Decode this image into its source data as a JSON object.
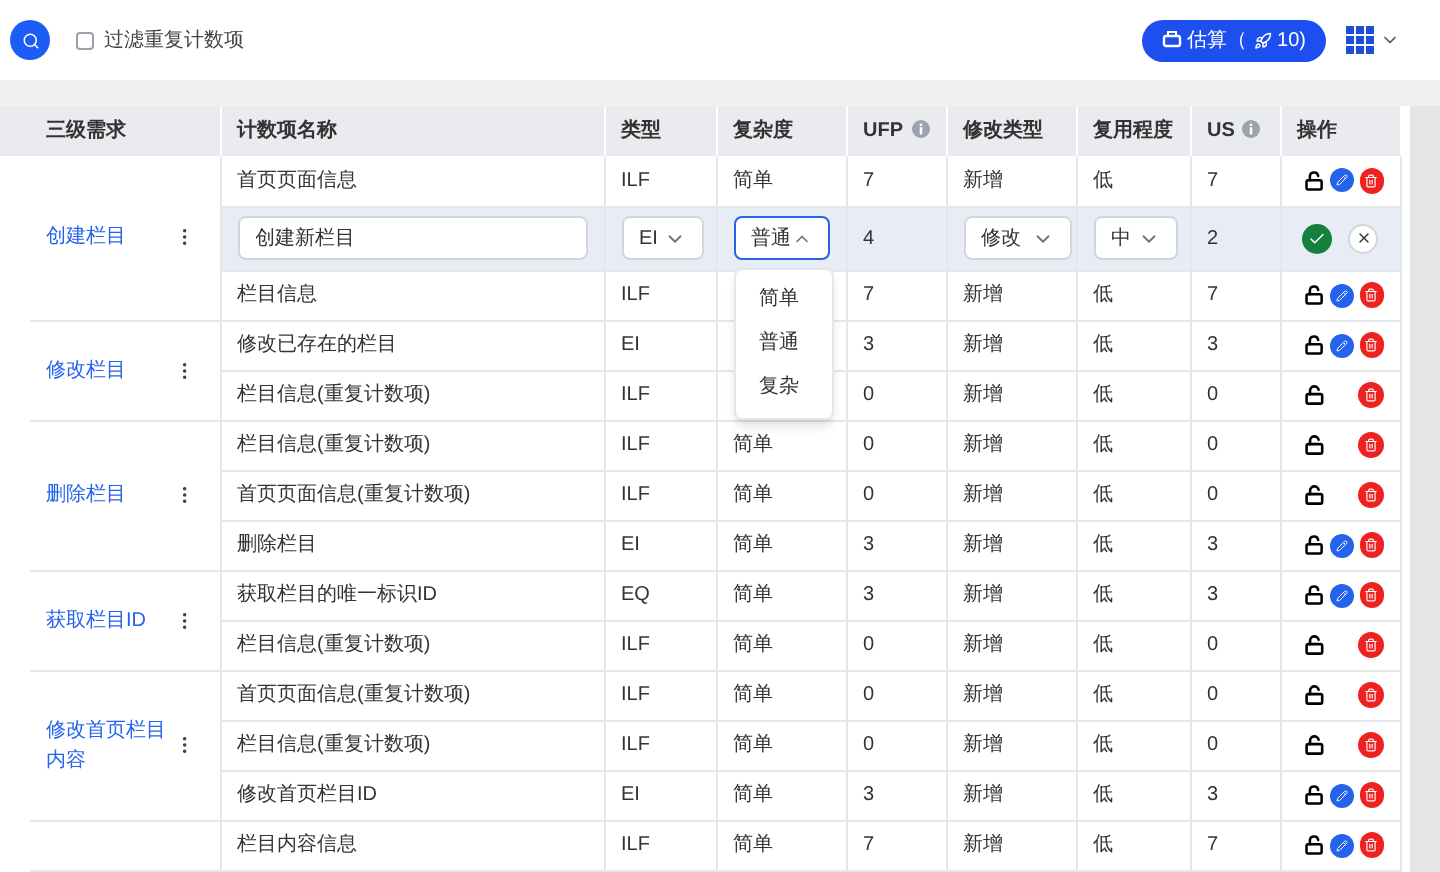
{
  "toolbar": {
    "filter": {
      "label": "过滤重复计数项",
      "checked": false
    },
    "estimate_button": {
      "label": "估算（",
      "count": "10)"
    }
  },
  "table": {
    "columns": [
      "三级需求",
      "计数项名称",
      "类型",
      "复杂度",
      "UFP",
      "修改类型",
      "复用程度",
      "US",
      "操作"
    ],
    "groups": [
      {
        "name": "创建栏目",
        "rows": [
          {
            "kind": "normal",
            "name": "首页页面信息",
            "type": "ILF",
            "complexity": "简单",
            "ufp": "7",
            "change": "新增",
            "reuse": "低",
            "us": "7",
            "editable": true
          },
          {
            "kind": "editing",
            "name": "创建新栏目",
            "type": "EI",
            "complexity": "普通",
            "ufp": "4",
            "change": "修改",
            "reuse": "中",
            "us": "2",
            "dropdown_open": true,
            "options": [
              "简单",
              "普通",
              "复杂"
            ]
          },
          {
            "kind": "normal",
            "name": "栏目信息",
            "type": "ILF",
            "ufp": "7",
            "change": "新增",
            "reuse": "低",
            "us": "7",
            "editable": true
          }
        ]
      },
      {
        "name": "修改栏目",
        "rows": [
          {
            "kind": "normal",
            "name": "修改已存在的栏目",
            "type": "EI",
            "ufp": "3",
            "change": "新增",
            "reuse": "低",
            "us": "3",
            "editable": true
          },
          {
            "kind": "normal",
            "name": "栏目信息(重复计数项)",
            "type": "ILF",
            "ufp": "0",
            "change": "新增",
            "reuse": "低",
            "us": "0",
            "editable": false
          }
        ]
      },
      {
        "name": "删除栏目",
        "rows": [
          {
            "kind": "normal",
            "name": "栏目信息(重复计数项)",
            "type": "ILF",
            "complexity": "简单",
            "ufp": "0",
            "change": "新增",
            "reuse": "低",
            "us": "0",
            "editable": false
          },
          {
            "kind": "normal",
            "name": "首页页面信息(重复计数项)",
            "type": "ILF",
            "complexity": "简单",
            "ufp": "0",
            "change": "新增",
            "reuse": "低",
            "us": "0",
            "editable": false
          },
          {
            "kind": "normal",
            "name": "删除栏目",
            "type": "EI",
            "complexity": "简单",
            "ufp": "3",
            "change": "新增",
            "reuse": "低",
            "us": "3",
            "editable": true
          }
        ]
      },
      {
        "name": "获取栏目ID",
        "rows": [
          {
            "kind": "normal",
            "name": "获取栏目的唯一标识ID",
            "type": "EQ",
            "complexity": "简单",
            "ufp": "3",
            "change": "新增",
            "reuse": "低",
            "us": "3",
            "editable": true
          },
          {
            "kind": "normal",
            "name": "栏目信息(重复计数项)",
            "type": "ILF",
            "complexity": "简单",
            "ufp": "0",
            "change": "新增",
            "reuse": "低",
            "us": "0",
            "editable": false
          }
        ]
      },
      {
        "name": "修改首页栏目内容",
        "rows": [
          {
            "kind": "normal",
            "name": "首页页面信息(重复计数项)",
            "type": "ILF",
            "complexity": "简单",
            "ufp": "0",
            "change": "新增",
            "reuse": "低",
            "us": "0",
            "editable": false
          },
          {
            "kind": "normal",
            "name": "栏目信息(重复计数项)",
            "type": "ILF",
            "complexity": "简单",
            "ufp": "0",
            "change": "新增",
            "reuse": "低",
            "us": "0",
            "editable": false
          },
          {
            "kind": "normal",
            "name": "修改首页栏目ID",
            "type": "EI",
            "complexity": "简单",
            "ufp": "3",
            "change": "新增",
            "reuse": "低",
            "us": "3",
            "editable": true
          }
        ]
      },
      {
        "rows": [
          {
            "kind": "normal",
            "name": "栏目内容信息",
            "type": "ILF",
            "complexity": "简单",
            "ufp": "7",
            "change": "新增",
            "reuse": "低",
            "us": "7",
            "editable": true
          }
        ]
      }
    ]
  }
}
